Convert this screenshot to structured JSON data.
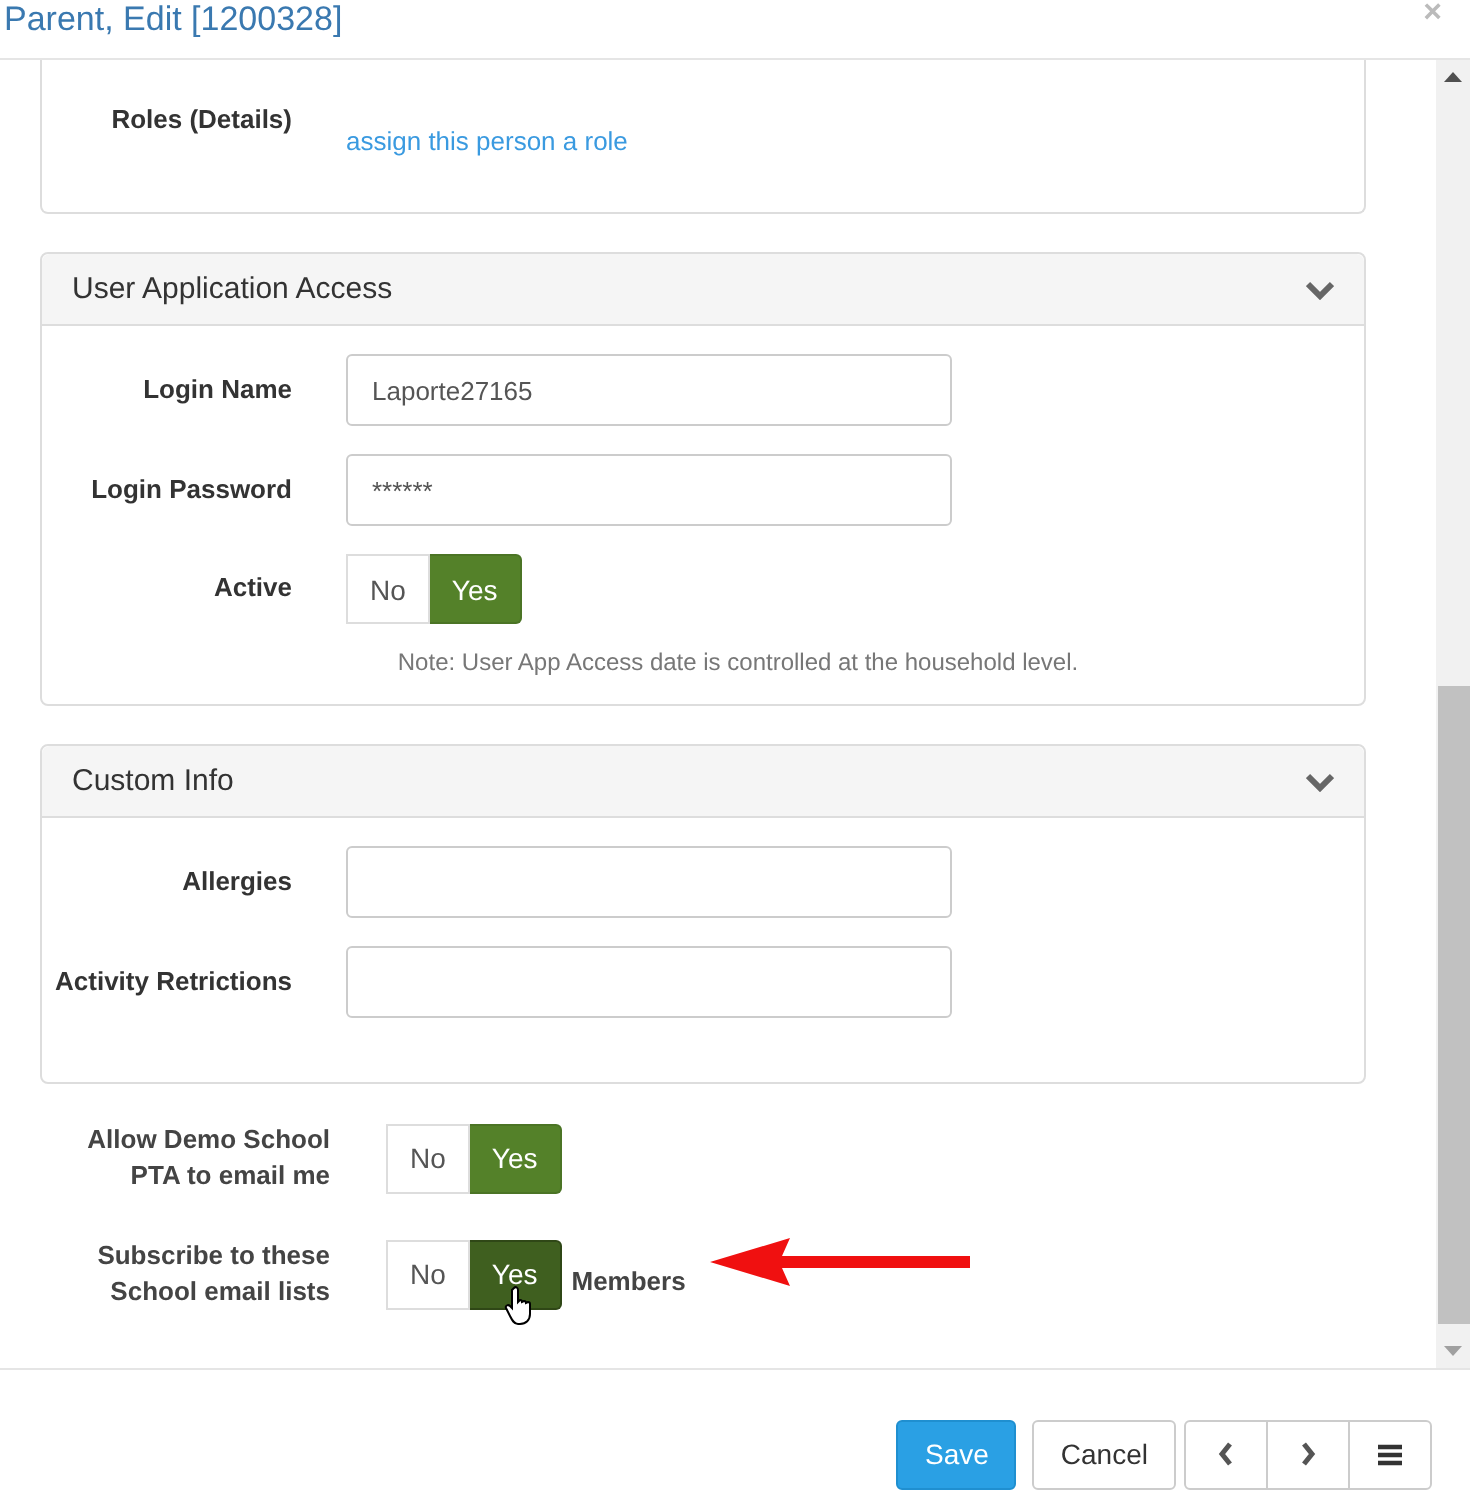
{
  "window": {
    "title": "Parent, Edit [1200328]",
    "close": "×"
  },
  "roles": {
    "label": "Roles (Details)",
    "link": "assign this person a role"
  },
  "panels": [
    {
      "title": "User Application Access",
      "expanded": true,
      "fields": [
        {
          "kind": "text",
          "label": "Login Name",
          "value": "Laporte27165"
        },
        {
          "kind": "password",
          "label": "Login Password",
          "value": "******"
        },
        {
          "kind": "toggle",
          "label": "Active",
          "options": [
            {
              "label": "No",
              "selected": false,
              "hovered": false
            },
            {
              "label": "Yes",
              "selected": true,
              "hovered": false
            }
          ]
        }
      ],
      "note": "Note: User App Access date is controlled at the household level."
    },
    {
      "title": "Custom Info",
      "expanded": true,
      "fields": [
        {
          "kind": "text",
          "label": "Allergies"
        },
        {
          "kind": "text",
          "label": "Activity Retrictions"
        }
      ]
    }
  ],
  "preferences": [
    {
      "label": "Allow Demo School PTA to email me",
      "options": [
        {
          "label": "No",
          "selected": false,
          "hovered": false
        },
        {
          "label": "Yes",
          "selected": true,
          "hovered": false
        }
      ]
    },
    {
      "label": "Subscribe to these School email lists",
      "options": [
        {
          "label": "No",
          "selected": false,
          "hovered": false
        },
        {
          "label": "Yes",
          "selected": true,
          "hovered": true
        }
      ],
      "suffix": "Members"
    }
  ],
  "footer": {
    "buttons": [
      {
        "kind": "primary",
        "label": "Save"
      },
      {
        "kind": "default",
        "label": "Cancel"
      }
    ]
  }
}
